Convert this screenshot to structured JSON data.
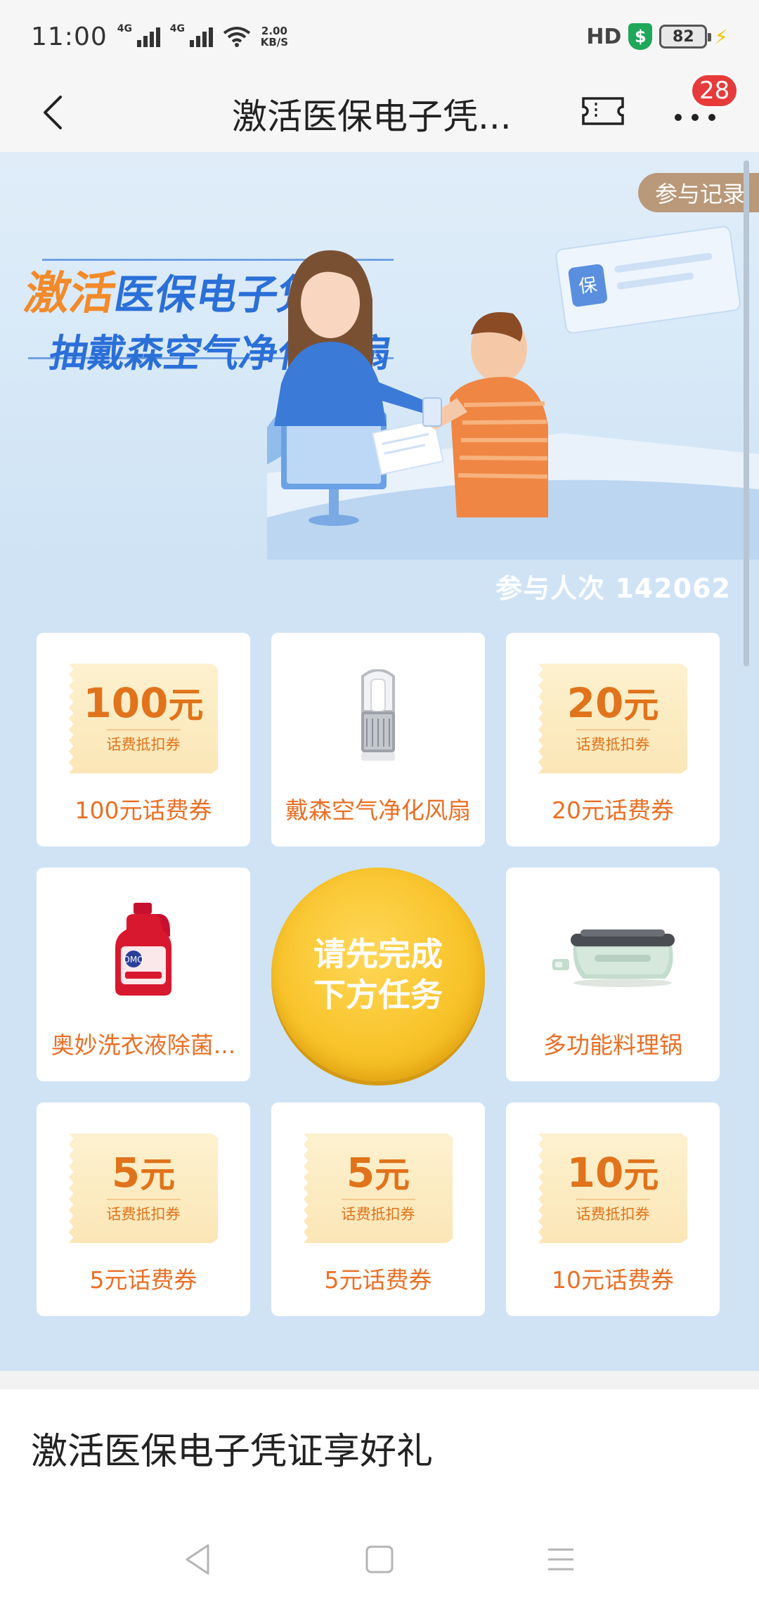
{
  "status_bar": {
    "time": "11:00",
    "signal1_tag": "4G",
    "signal2_tag": "4G",
    "net_speed_value": "2.00",
    "net_speed_unit": "KB/S",
    "hd_label": "HD",
    "battery_level": "82"
  },
  "header": {
    "title": "激活医保电子凭...",
    "notification_count": "28"
  },
  "banner": {
    "record_button": "参与记录",
    "slogan_line1_highlight": "激活",
    "slogan_line1_rest": "医保电子凭证",
    "slogan_line2": "抽戴森空气净化风扇",
    "participants_label": "参与人次",
    "participants_count": "142062"
  },
  "prizes": [
    {
      "label": "100元话费券",
      "coupon_amount": "100",
      "coupon_unit": "元",
      "coupon_sub": "话费抵扣券"
    },
    {
      "label": "戴森空气净化风扇",
      "icon": "dyson-air-purifier-icon"
    },
    {
      "label": "20元话费券",
      "coupon_amount": "20",
      "coupon_unit": "元",
      "coupon_sub": "话费抵扣券"
    },
    {
      "label": "奥妙洗衣液除菌...",
      "icon": "omo-detergent-bottle-icon"
    },
    {
      "label": "多功能料理锅",
      "icon": "multifunction-cooker-icon"
    },
    {
      "label": "5元话费券",
      "coupon_amount": "5",
      "coupon_unit": "元",
      "coupon_sub": "话费抵扣券"
    },
    {
      "label": "5元话费券",
      "coupon_amount": "5",
      "coupon_unit": "元",
      "coupon_sub": "话费抵扣券"
    },
    {
      "label": "10元话费券",
      "coupon_amount": "10",
      "coupon_unit": "元",
      "coupon_sub": "话费抵扣券"
    }
  ],
  "draw_button": {
    "line1": "请先完成",
    "line2": "下方任务"
  },
  "section": {
    "title": "激活医保电子凭证享好礼"
  },
  "colors": {
    "accent_orange": "#ea6f25",
    "brand_blue": "#2b6fd8",
    "draw_button_gold": "#f8c42b",
    "badge_red": "#e73a3a",
    "page_blue": "#cfe3f5"
  }
}
